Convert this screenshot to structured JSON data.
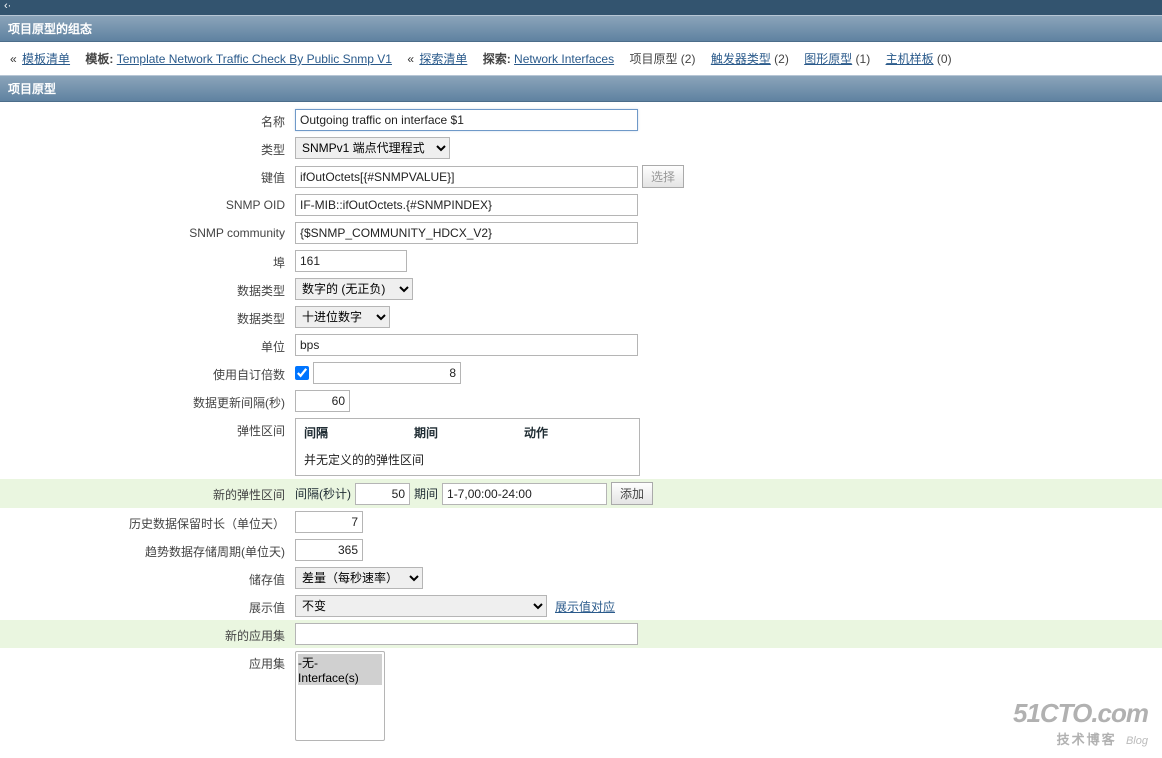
{
  "topBar": "‹·",
  "header1": "项目原型的组态",
  "header2": "项目原型",
  "breadcrumb": {
    "l1": "模板清单",
    "tplLabel": "模板:",
    "tplLink": "Template Network Traffic Check By Public Snmp V1",
    "l2": "探索清单",
    "exploreLabel": "探索:",
    "exploreLink": "Network Interfaces",
    "itemProto": "项目原型",
    "itemProtoCount": "(2)",
    "trigProto": "触发器类型",
    "trigProtoCount": "(2)",
    "graphProto": "图形原型",
    "graphProtoCount": "(1)",
    "hostProto": "主机样板",
    "hostProtoCount": "(0)"
  },
  "labels": {
    "name": "名称",
    "type": "类型",
    "key": "键值",
    "snmpOid": "SNMP OID",
    "snmpComm": "SNMP community",
    "port": "埠",
    "dataType1": "数据类型",
    "dataType2": "数据类型",
    "unit": "单位",
    "multiplier": "使用自订倍数",
    "updateInt": "数据更新间隔(秒)",
    "elastic": "弹性区间",
    "newElastic": "新的弹性区间",
    "elasticIntLabel": "间隔(秒计)",
    "elasticPeriodLabel": "期间",
    "addBtn": "添加",
    "history": "历史数据保留时长（单位天）",
    "trend": "趋势数据存储周期(单位天)",
    "store": "储存值",
    "display": "展示值",
    "displayLink": "展示值对应",
    "newAppSet": "新的应用集",
    "appSet": "应用集",
    "selectBtn": "选择"
  },
  "values": {
    "name": "Outgoing traffic on interface $1",
    "type": "SNMPv1 端点代理程式",
    "key": "ifOutOctets[{#SNMPVALUE}]",
    "snmpOid": "IF-MIB::ifOutOctets.{#SNMPINDEX}",
    "snmpComm": "{$SNMP_COMMUNITY_HDCX_V2}",
    "port": "161",
    "dataType1": "数字的 (无正负)",
    "dataType2": "十进位数字",
    "unit": "bps",
    "multiplierChecked": true,
    "multiplierVal": "8",
    "updateInt": "60",
    "elasticHeaders": {
      "c1": "间隔",
      "c2": "期间",
      "c3": "动作"
    },
    "elasticEmpty": "并无定义的的弹性区间",
    "newInterval": "50",
    "newPeriod": "1-7,00:00-24:00",
    "history": "7",
    "trend": "365",
    "store": "差量（每秒速率）",
    "display": "不变",
    "newAppSet": "",
    "appOptions": [
      "-无-",
      "Interface(s)"
    ]
  },
  "watermark": {
    "big": "51CTO.com",
    "small": "技术博客",
    "blog": "Blog"
  }
}
